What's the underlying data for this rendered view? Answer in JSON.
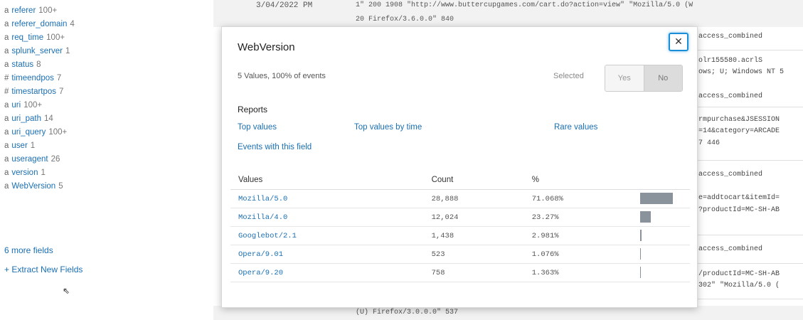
{
  "sidebar": {
    "fields": [
      {
        "type": "a",
        "name": "referer",
        "count": "100+"
      },
      {
        "type": "a",
        "name": "referer_domain",
        "count": "4"
      },
      {
        "type": "a",
        "name": "req_time",
        "count": "100+"
      },
      {
        "type": "a",
        "name": "splunk_server",
        "count": "1"
      },
      {
        "type": "a",
        "name": "status",
        "count": "8"
      },
      {
        "type": "#",
        "name": "timeendpos",
        "count": "7"
      },
      {
        "type": "#",
        "name": "timestartpos",
        "count": "7"
      },
      {
        "type": "a",
        "name": "uri",
        "count": "100+"
      },
      {
        "type": "a",
        "name": "uri_path",
        "count": "14"
      },
      {
        "type": "a",
        "name": "uri_query",
        "count": "100+"
      },
      {
        "type": "a",
        "name": "user",
        "count": "1"
      },
      {
        "type": "a",
        "name": "useragent",
        "count": "26"
      },
      {
        "type": "a",
        "name": "version",
        "count": "1"
      },
      {
        "type": "a",
        "name": "WebVersion",
        "count": "5"
      }
    ],
    "more_fields": "6 more fields",
    "extract_fields": "+ Extract New Fields",
    "cursor": "⇖"
  },
  "events": {
    "top_time": "3/04/2022 PM",
    "top_line": "1\" 200 1908 \"http://www.buttercupgames.com/cart.do?action=view\" \"Mozilla/5.0 (W",
    "top_line2": "20 Firefox/3.6.0.0\" 840",
    "bottom_line": "(U) Firefox/3.0.0.0\" 537",
    "right_lines": [
      "access_combined",
      "olr155580.acrlS",
      "ows; U; Windows NT 5",
      "access_combined",
      "rmpurchase&JSESSION",
      "=14&category=ARCADE",
      "7 446",
      "access_combined",
      "e=addtocart&itemId=",
      "?productId=MC-SH-AB",
      "access_combined",
      "/productId=MC-SH-AB",
      "302\" \"Mozilla/5.0 ("
    ]
  },
  "modal": {
    "title": "WebVersion",
    "summary": "5 Values, 100% of events",
    "selected_label": "Selected",
    "toggle_yes": "Yes",
    "toggle_no": "No",
    "close": "✕",
    "reports_label": "Reports",
    "links": {
      "top_values": "Top values",
      "top_values_by_time": "Top values by time",
      "rare_values": "Rare values",
      "events_with_field": "Events with this field"
    },
    "table": {
      "headers": {
        "value": "Values",
        "count": "Count",
        "percent": "%"
      },
      "rows": [
        {
          "value": "Mozilla/5.0",
          "count": "28,888",
          "percent": "71.068%",
          "fraction": 0.71068
        },
        {
          "value": "Mozilla/4.0",
          "count": "12,024",
          "percent": "23.27%",
          "fraction": 0.2327
        },
        {
          "value": "Googlebot/2.1",
          "count": "1,438",
          "percent": "2.981%",
          "fraction": 0.02981
        },
        {
          "value": "Opera/9.01",
          "count": "523",
          "percent": "1.076%",
          "fraction": 0.01076
        },
        {
          "value": "Opera/9.20",
          "count": "758",
          "percent": "1.363%",
          "fraction": 0.01363
        }
      ]
    }
  },
  "colors": {
    "accent": "#1a6fb3",
    "bar": "#8a929b",
    "close_border": "#1a8fd8"
  }
}
